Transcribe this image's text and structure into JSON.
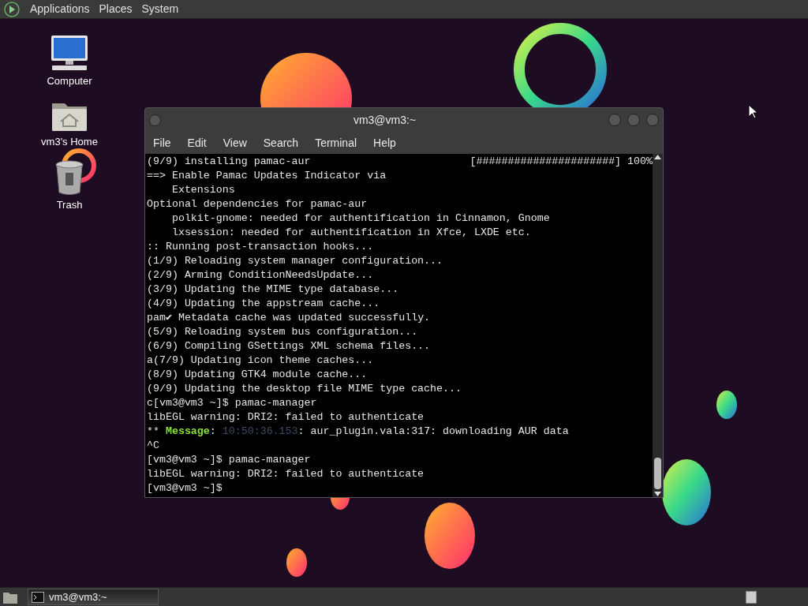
{
  "top_panel": {
    "menus": [
      "Applications",
      "Places",
      "System"
    ]
  },
  "desktop_icons": [
    {
      "kind": "computer",
      "label": "Computer"
    },
    {
      "kind": "home",
      "label": "vm3's Home"
    },
    {
      "kind": "trash",
      "label": "Trash"
    }
  ],
  "terminal": {
    "title": "vm3@vm3:~",
    "menu": [
      "File",
      "Edit",
      "View",
      "Search",
      "Terminal",
      "Help"
    ],
    "lines": [
      {
        "parts": [
          {
            "kind": "plain",
            "text": "(9/9) installing pamac-aur"
          }
        ],
        "right": "[######################] 100%"
      },
      {
        "parts": [
          {
            "kind": "plain",
            "text": "==> Enable Pamac Updates Indicator via"
          }
        ]
      },
      {
        "parts": [
          {
            "kind": "plain",
            "text": "    Extensions"
          }
        ]
      },
      {
        "parts": [
          {
            "kind": "plain",
            "text": "Optional dependencies for pamac-aur"
          }
        ]
      },
      {
        "parts": [
          {
            "kind": "plain",
            "text": "    polkit-gnome: needed for authentification in Cinnamon, Gnome"
          }
        ]
      },
      {
        "parts": [
          {
            "kind": "plain",
            "text": "    lxsession: needed for authentification in Xfce, LXDE etc."
          }
        ]
      },
      {
        "parts": [
          {
            "kind": "plain",
            "text": ":: Running post-transaction hooks..."
          }
        ]
      },
      {
        "parts": [
          {
            "kind": "plain",
            "text": "(1/9) Reloading system manager configuration..."
          }
        ]
      },
      {
        "parts": [
          {
            "kind": "plain",
            "text": "(2/9) Arming ConditionNeedsUpdate..."
          }
        ]
      },
      {
        "parts": [
          {
            "kind": "plain",
            "text": "(3/9) Updating the MIME type database..."
          }
        ]
      },
      {
        "parts": [
          {
            "kind": "plain",
            "text": "(4/9) Updating the appstream cache..."
          }
        ]
      },
      {
        "parts": [
          {
            "kind": "plain",
            "text": "pam✔ Metadata cache was updated successfully."
          }
        ]
      },
      {
        "parts": [
          {
            "kind": "plain",
            "text": "(5/9) Reloading system bus configuration..."
          }
        ]
      },
      {
        "parts": [
          {
            "kind": "plain",
            "text": "(6/9) Compiling GSettings XML schema files..."
          }
        ]
      },
      {
        "parts": [
          {
            "kind": "plain",
            "text": "a(7/9) Updating icon theme caches..."
          }
        ]
      },
      {
        "parts": [
          {
            "kind": "plain",
            "text": "(8/9) Updating GTK4 module cache..."
          }
        ]
      },
      {
        "parts": [
          {
            "kind": "plain",
            "text": "(9/9) Updating the desktop file MIME type cache..."
          }
        ]
      },
      {
        "parts": [
          {
            "kind": "plain",
            "text": "c[vm3@vm3 ~]$ pamac-manager"
          }
        ]
      },
      {
        "parts": [
          {
            "kind": "plain",
            "text": "libEGL warning: DRI2: failed to authenticate"
          }
        ]
      },
      {
        "parts": [
          {
            "kind": "plain",
            "text": "** "
          },
          {
            "kind": "label",
            "text": "Message"
          },
          {
            "kind": "plain",
            "text": ": "
          },
          {
            "kind": "timestamp",
            "text": "10:50:36.153"
          },
          {
            "kind": "plain",
            "text": ": aur_plugin.vala:317: downloading AUR data"
          }
        ]
      },
      {
        "parts": [
          {
            "kind": "plain",
            "text": "^C"
          }
        ]
      },
      {
        "parts": [
          {
            "kind": "plain",
            "text": "[vm3@vm3 ~]$ pamac-manager"
          }
        ]
      },
      {
        "parts": [
          {
            "kind": "plain",
            "text": "libEGL warning: DRI2: failed to authenticate"
          }
        ]
      },
      {
        "parts": [
          {
            "kind": "plain",
            "text": "[vm3@vm3 ~]$"
          }
        ]
      }
    ]
  },
  "taskbar": {
    "windows": [
      {
        "title": "vm3@vm3:~",
        "selected": true
      }
    ]
  }
}
